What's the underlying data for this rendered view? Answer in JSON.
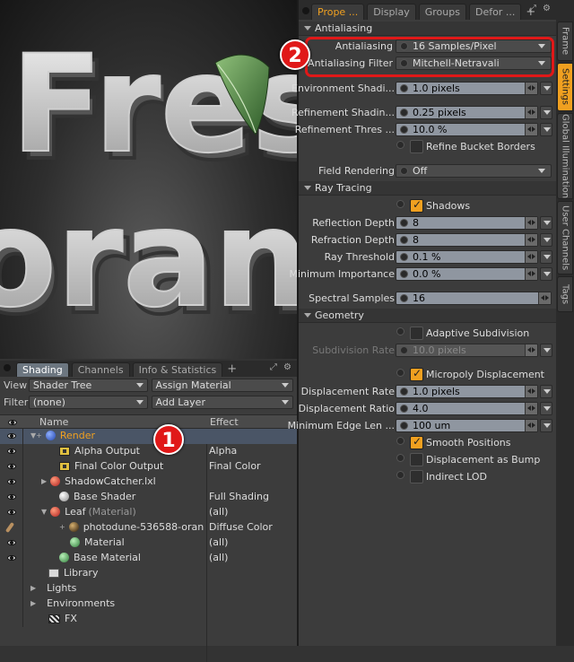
{
  "viewport": {
    "render_text_1": "Fres",
    "render_text_2": "orang"
  },
  "shading_panel": {
    "tabs": [
      "Shading",
      "Channels",
      "Info & Statistics"
    ],
    "tab_add": "+",
    "view_label": "View",
    "view_value": "Shader Tree",
    "assign_material": "Assign Material",
    "filter_label": "Filter",
    "filter_value": "(none)",
    "add_layer": "Add Layer",
    "columns": {
      "name": "Name",
      "effect": "Effect"
    },
    "rows": [
      {
        "name": "Render",
        "effect": "",
        "icon": "render-sphere-icon"
      },
      {
        "name": "Alpha Output",
        "effect": "Alpha",
        "icon": "output-icon"
      },
      {
        "name": "Final Color Output",
        "effect": "Final Color",
        "icon": "output-icon"
      },
      {
        "name": "ShadowCatcher.lxl",
        "effect": "",
        "icon": "material-group-icon"
      },
      {
        "name": "Base Shader",
        "effect": "Full Shading",
        "icon": "shader-icon"
      },
      {
        "name": "Leaf",
        "suffix": "(Material)",
        "effect": "(all)",
        "icon": "material-group-icon"
      },
      {
        "name": "photodune-536588-oran",
        "effect": "Diffuse Color",
        "icon": "image-icon"
      },
      {
        "name": "Material",
        "effect": "(all)",
        "icon": "material-icon"
      },
      {
        "name": "Base Material",
        "effect": "(all)",
        "icon": "material-icon"
      },
      {
        "name": "Library",
        "effect": "",
        "icon": "folder-icon"
      },
      {
        "name": "Lights",
        "effect": ""
      },
      {
        "name": "Environments",
        "effect": ""
      },
      {
        "name": "FX",
        "effect": "",
        "icon": "clapper-icon"
      }
    ]
  },
  "properties_panel": {
    "tabs": [
      "Prope ...",
      "Display",
      "Groups",
      "Defor ..."
    ],
    "tab_add": "+",
    "sections": {
      "antialiasing": "Antialiasing",
      "ray_tracing": "Ray Tracing",
      "geometry": "Geometry"
    },
    "fields": {
      "antialiasing": {
        "label": "Antialiasing",
        "value": "16 Samples/Pixel"
      },
      "antialiasing_filter": {
        "label": "Antialiasing Filter",
        "value": "Mitchell-Netravali"
      },
      "environment_shading": {
        "label": "Environment Shadi...",
        "value": "1.0 pixels"
      },
      "refinement_shading": {
        "label": "Refinement Shadin...",
        "value": "0.25 pixels"
      },
      "refinement_threshold": {
        "label": "Refinement Thres ...",
        "value": "10.0 %"
      },
      "refine_bucket_borders": {
        "label": "Refine Bucket Borders",
        "checked": false
      },
      "field_rendering": {
        "label": "Field Rendering",
        "value": "Off"
      },
      "shadows": {
        "label": "Shadows",
        "checked": true
      },
      "reflection_depth": {
        "label": "Reflection Depth",
        "value": "8"
      },
      "refraction_depth": {
        "label": "Refraction Depth",
        "value": "8"
      },
      "ray_threshold": {
        "label": "Ray Threshold",
        "value": "0.1 %"
      },
      "minimum_importance": {
        "label": "Minimum Importance",
        "value": "0.0 %"
      },
      "spectral_samples": {
        "label": "Spectral Samples",
        "value": "16"
      },
      "adaptive_subdivision": {
        "label": "Adaptive Subdivision",
        "checked": false
      },
      "subdivision_rate": {
        "label": "Subdivision Rate",
        "value": "10.0 pixels"
      },
      "micropoly_displacement": {
        "label": "Micropoly Displacement",
        "checked": true
      },
      "displacement_rate": {
        "label": "Displacement Rate",
        "value": "1.0 pixels"
      },
      "displacement_ratio": {
        "label": "Displacement Ratio",
        "value": "4.0"
      },
      "minimum_edge_length": {
        "label": "Minimum Edge Len ...",
        "value": "100 um"
      },
      "smooth_positions": {
        "label": "Smooth Positions",
        "checked": true
      },
      "displacement_as_bump": {
        "label": "Displacement as Bump",
        "checked": false
      },
      "indirect_lod": {
        "label": "Indirect LOD",
        "checked": false
      }
    },
    "side_tabs": [
      "Frame",
      "Settings",
      "Global Illumination",
      "User Channels",
      "Tags"
    ]
  },
  "annotations": {
    "badge_1": "1",
    "badge_2": "2"
  },
  "colors": {
    "accent": "#f0a020",
    "highlight": "#e01818",
    "selection": "#4a5566"
  }
}
